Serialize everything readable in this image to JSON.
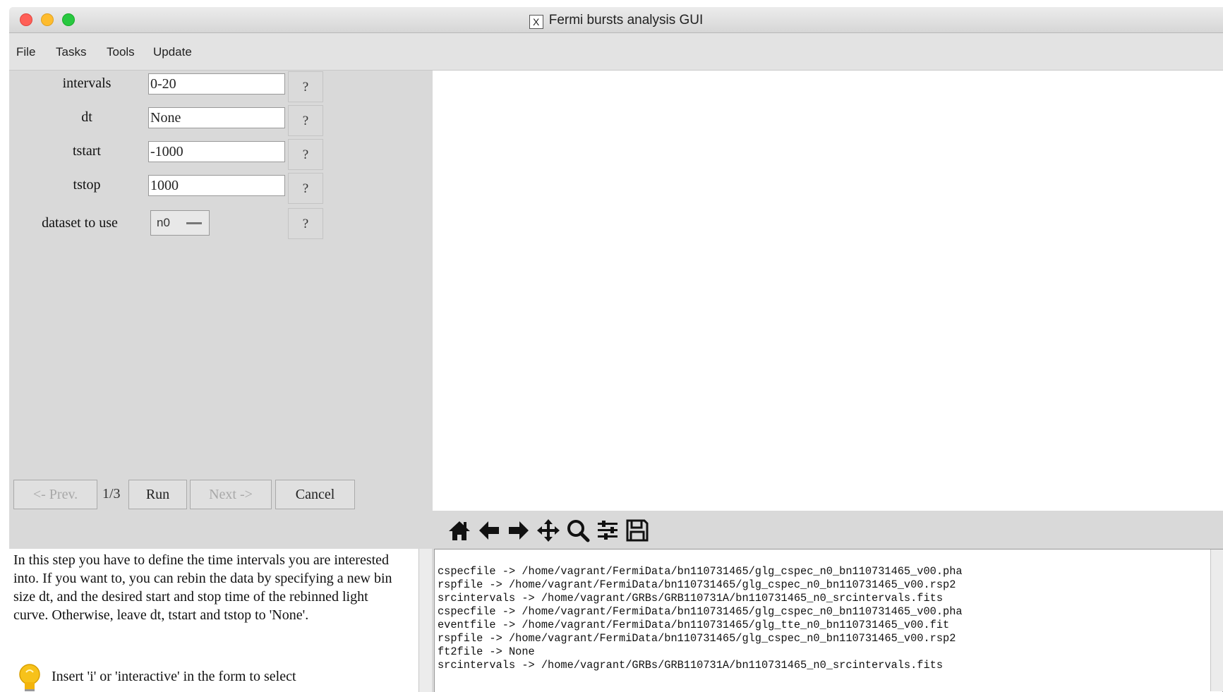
{
  "window": {
    "title": "Fermi bursts analysis GUI"
  },
  "menu": {
    "items": [
      "File",
      "Tasks",
      "Tools",
      "Update"
    ]
  },
  "form": {
    "fields": [
      {
        "label": "intervals",
        "value": "0-20",
        "help": "?"
      },
      {
        "label": "dt",
        "value": "None",
        "help": "?"
      },
      {
        "label": "tstart",
        "value": "-1000",
        "help": "?"
      },
      {
        "label": "tstop",
        "value": "1000",
        "help": "?"
      }
    ],
    "dataset": {
      "label": "dataset to use",
      "value": "n0",
      "help": "?"
    }
  },
  "navigation": {
    "prev": "<- Prev.",
    "step": "1/3",
    "run": "Run",
    "next": "Next ->",
    "cancel": "Cancel"
  },
  "help_text": {
    "paragraph": "In this step you have to define the time intervals you are interested into. If you want to, you can rebin the data by specifying a new bin size dt, and the desired start and stop time of the rebinned light curve. Otherwise, leave dt, tstart and tstop to 'None'.",
    "tip": "Insert 'i' or 'interactive' in the form to select"
  },
  "plot_toolbar": {
    "icons": [
      "home-icon",
      "back-arrow-icon",
      "forward-arrow-icon",
      "pan-icon",
      "zoom-icon",
      "subplots-config-icon",
      "save-icon"
    ]
  },
  "console": {
    "lines": [
      "cspecfile -> /home/vagrant/FermiData/bn110731465/glg_cspec_n0_bn110731465_v00.pha",
      "rspfile -> /home/vagrant/FermiData/bn110731465/glg_cspec_n0_bn110731465_v00.rsp2",
      "srcintervals -> /home/vagrant/GRBs/GRB110731A/bn110731465_n0_srcintervals.fits",
      "cspecfile -> /home/vagrant/FermiData/bn110731465/glg_cspec_n0_bn110731465_v00.pha",
      "eventfile -> /home/vagrant/FermiData/bn110731465/glg_tte_n0_bn110731465_v00.fit",
      "rspfile -> /home/vagrant/FermiData/bn110731465/glg_cspec_n0_bn110731465_v00.rsp2",
      "ft2file -> None",
      "srcintervals -> /home/vagrant/GRBs/GRB110731A/bn110731465_n0_srcintervals.fits"
    ]
  }
}
